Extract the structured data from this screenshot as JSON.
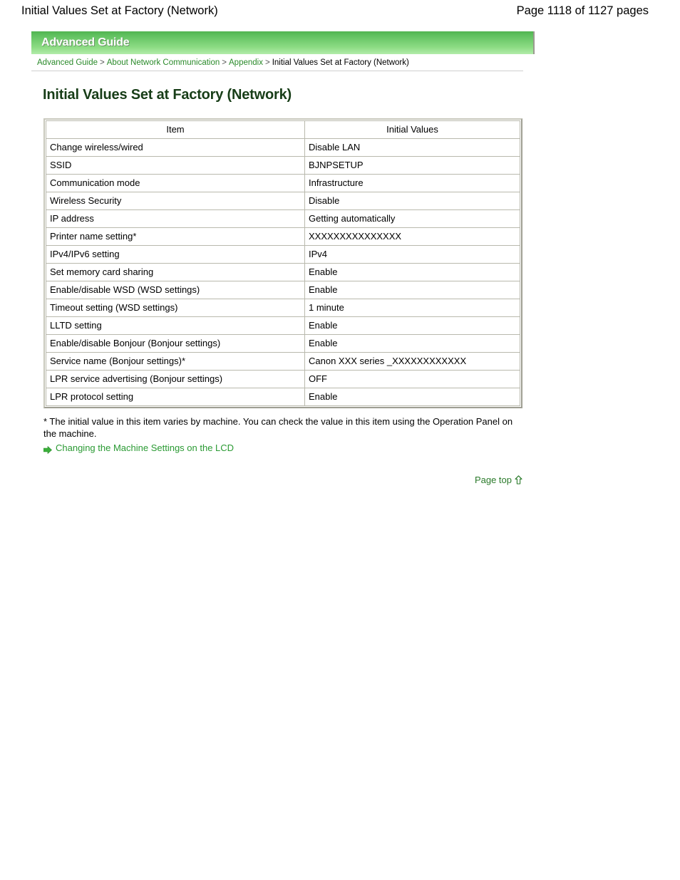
{
  "header": {
    "doc_title": "Initial Values Set at Factory (Network)",
    "page_count": "Page 1118 of 1127 pages"
  },
  "banner": {
    "label": "Advanced Guide"
  },
  "breadcrumb": {
    "items": [
      {
        "label": "Advanced Guide",
        "link": true
      },
      {
        "label": "About Network Communication",
        "link": true
      },
      {
        "label": "Appendix",
        "link": true
      },
      {
        "label": "Initial Values Set at Factory (Network)",
        "link": false
      }
    ],
    "separator": ">"
  },
  "page_title": "Initial Values Set at Factory (Network)",
  "table": {
    "columns": [
      "Item",
      "Initial Values"
    ],
    "rows": [
      [
        "Change wireless/wired",
        "Disable LAN"
      ],
      [
        "SSID",
        "BJNPSETUP"
      ],
      [
        "Communication mode",
        "Infrastructure"
      ],
      [
        "Wireless Security",
        "Disable"
      ],
      [
        "IP address",
        "Getting automatically"
      ],
      [
        "Printer name setting*",
        "XXXXXXXXXXXXXXX"
      ],
      [
        "IPv4/IPv6 setting",
        "IPv4"
      ],
      [
        "Set memory card sharing",
        "Enable"
      ],
      [
        "Enable/disable WSD (WSD settings)",
        "Enable"
      ],
      [
        "Timeout setting (WSD settings)",
        "1 minute"
      ],
      [
        "LLTD setting",
        "Enable"
      ],
      [
        "Enable/disable Bonjour (Bonjour settings)",
        "Enable"
      ],
      [
        "Service name (Bonjour settings)*",
        "Canon XXX series _XXXXXXXXXXXX"
      ],
      [
        "LPR service advertising (Bonjour settings)",
        "OFF"
      ],
      [
        "LPR protocol setting",
        "Enable"
      ]
    ]
  },
  "footnote": "* The initial value in this item varies by machine. You can check the value in this item using the Operation Panel on the machine.",
  "related_link": {
    "icon": "green-right-arrow-icon",
    "label": "Changing the Machine Settings on the LCD"
  },
  "page_top": {
    "label": "Page top",
    "icon": "up-arrow-icon"
  },
  "colors": {
    "banner_green_top": "#51b451",
    "banner_green_bottom": "#b2ecaa",
    "link_green": "#2a8a2a",
    "title_green": "#173d17",
    "table_border": "#9e9e92",
    "cell_border": "#b9b9ad"
  }
}
